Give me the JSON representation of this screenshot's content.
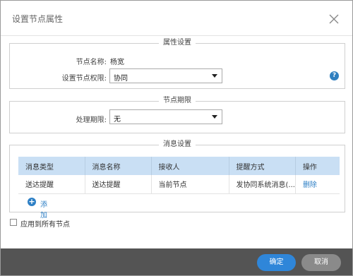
{
  "dialog": {
    "title": "设置节点属性",
    "close_icon": "close-icon"
  },
  "attributes": {
    "legend": "属性设置",
    "node_name_label": "节点名称:",
    "node_name_value": "杨宽",
    "permission_label": "设置节点权限:",
    "permission_value": "协同",
    "help_icon": "help-icon",
    "help_text": "?"
  },
  "deadline": {
    "legend": "节点期限",
    "label": "处理期限:",
    "value": "无"
  },
  "messages": {
    "legend": "消息设置",
    "columns": [
      "消息类型",
      "消息名称",
      "接收人",
      "提醒方式",
      "操作"
    ],
    "rows": [
      [
        "送达提醒",
        "送达提醒",
        "当前节点",
        "发协同系统消息(...",
        "删除"
      ]
    ],
    "add_label": "添加",
    "add_icon_text": "+"
  },
  "apply_all": {
    "label": "应用到所有节点",
    "checked": false
  },
  "footer": {
    "ok_label": "确定",
    "cancel_label": "取消"
  },
  "colors": {
    "primary": "#2f86d9",
    "link": "#2d7fc5",
    "header_bg": "#c9dff4",
    "footer_bg": "#545454",
    "cancel_bg": "#8a8a8a"
  }
}
